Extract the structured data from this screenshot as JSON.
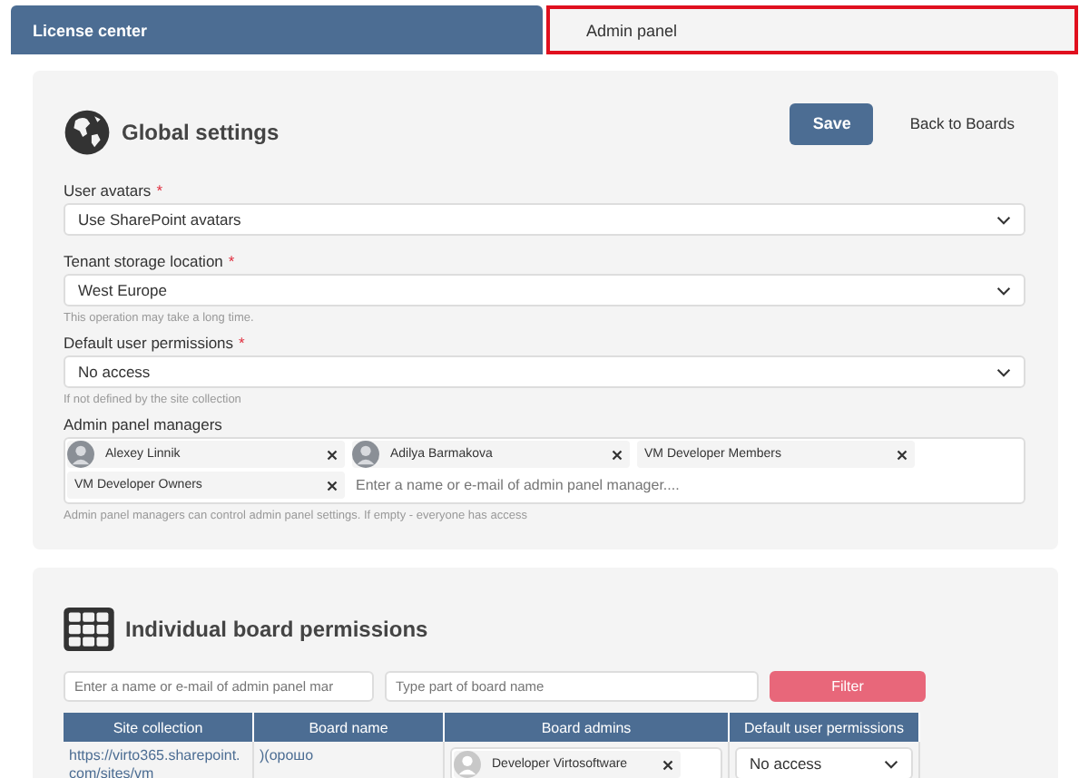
{
  "tabs": [
    {
      "label": "License center",
      "selected": true,
      "highlighted": false
    },
    {
      "label": "Admin panel",
      "selected": false,
      "highlighted": true
    }
  ],
  "global_settings": {
    "title": "Global settings",
    "save_button": "Save",
    "back_link": "Back to Boards",
    "fields": [
      {
        "label": "User avatars",
        "required_mark": "*",
        "value": "Use SharePoint avatars"
      },
      {
        "label": "Tenant storage location",
        "required_mark": "*",
        "value": "West Europe",
        "hint": "This operation may take a long time."
      },
      {
        "label": "Default user permissions",
        "required_mark": "*",
        "value": "No access",
        "hint": "If not defined by the site collection"
      }
    ],
    "managers": {
      "label": "Admin panel managers",
      "chips": [
        {
          "kind": "person",
          "name": "Alexey Linnik"
        },
        {
          "kind": "person",
          "name": "Adilya Barmakova"
        },
        {
          "kind": "group",
          "name": "VM Developer Members"
        },
        {
          "kind": "group",
          "name": "VM Developer Owners"
        }
      ],
      "placeholder": "Enter a name or e-mail of admin panel manager....",
      "hint": "Admin panel managers can control admin panel settings. If empty - everyone has access"
    }
  },
  "board_permissions": {
    "title": "Individual board permissions",
    "admin_filter_placeholder": "Enter a name or e-mail of admin panel mar",
    "board_filter_placeholder": "Type part of board name",
    "filter_button": "Filter",
    "table": {
      "columns": [
        "Site collection",
        "Board name",
        "Board admins",
        "Default user permissions"
      ],
      "rows": [
        {
          "site": "https://virto365.sharepoint.com/sites/vm",
          "board": ")(орошо",
          "admins": [
            "Developer Virtosoftware"
          ],
          "permission": "No access"
        }
      ]
    }
  }
}
